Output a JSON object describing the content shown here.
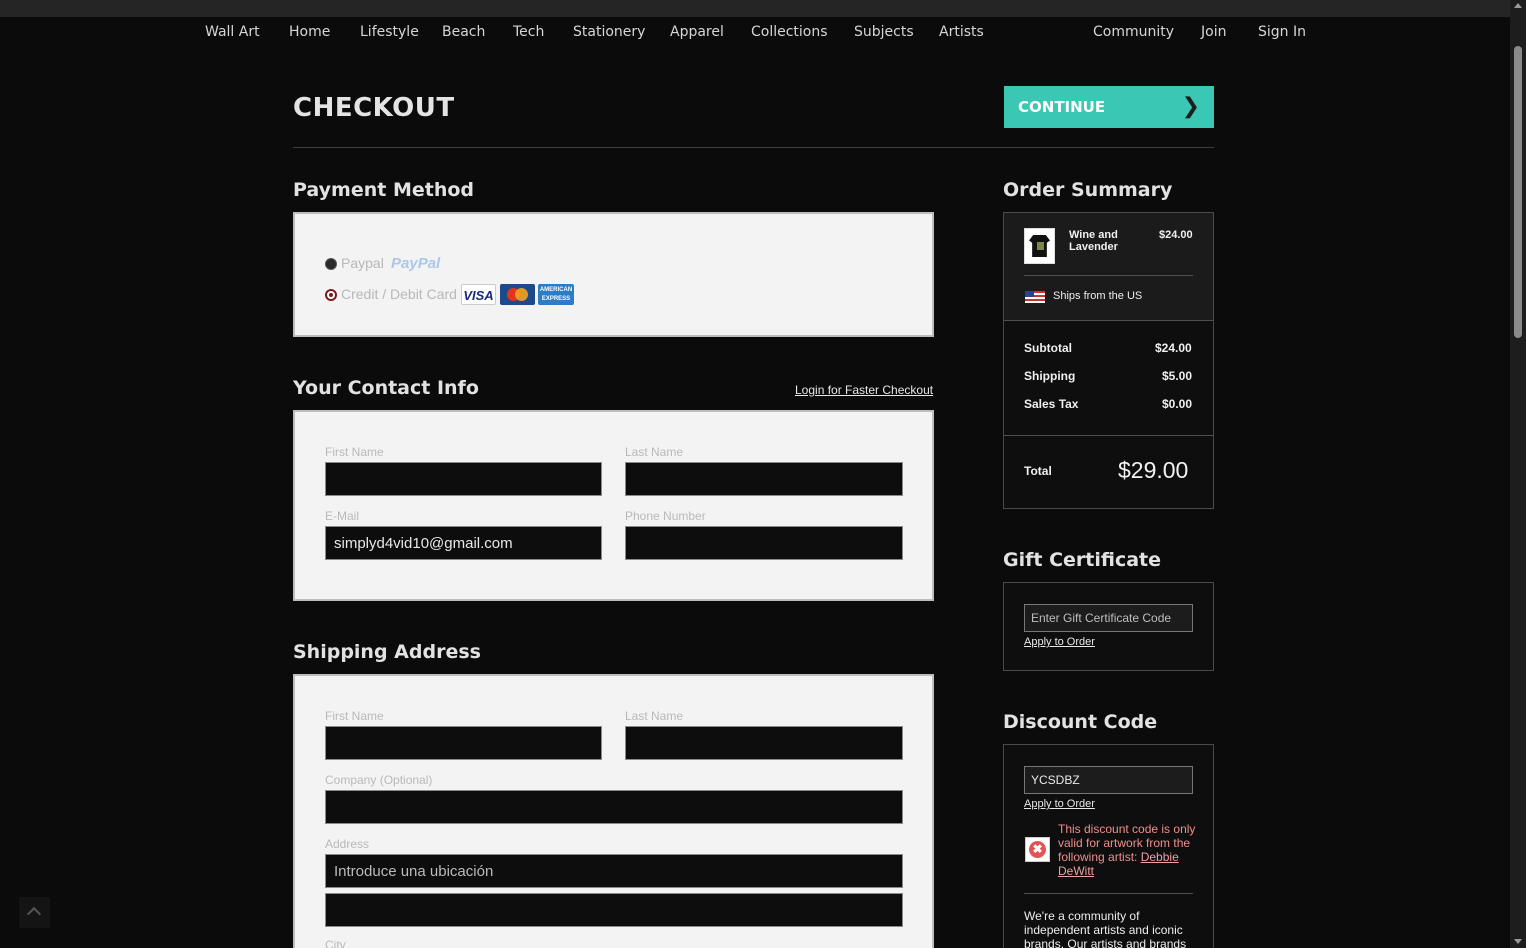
{
  "nav": {
    "left": [
      "Wall Art",
      "Home",
      "Lifestyle",
      "Beach",
      "Tech",
      "Stationery",
      "Apparel",
      "Collections",
      "Subjects",
      "Artists"
    ],
    "right": [
      "Community",
      "Join",
      "Sign In"
    ]
  },
  "header": {
    "title": "CHECKOUT",
    "continue_label": "CONTINUE"
  },
  "payment": {
    "title": "Payment Method",
    "paypal_label": "Paypal",
    "paypal_logo": "PayPal",
    "card_label": "Credit / Debit Card",
    "cards": [
      "VISA",
      "MasterCard",
      "AMERICAN EXPRESS"
    ],
    "selected": "Credit / Debit Card"
  },
  "contact": {
    "title": "Your Contact Info",
    "login_link": "Login for Faster Checkout",
    "first_name_label": "First Name",
    "last_name_label": "Last Name",
    "email_label": "E-Mail",
    "phone_label": "Phone Number",
    "email_value": "simplyd4vid10@gmail.com"
  },
  "shipping": {
    "title": "Shipping Address",
    "first_name_label": "First Name",
    "last_name_label": "Last Name",
    "company_label": "Company (Optional)",
    "address_label": "Address",
    "address_placeholder": "Introduce una ubicación",
    "city_label": "City"
  },
  "order_summary": {
    "title": "Order Summary",
    "item_name": "Wine and Lavender",
    "item_price": "$24.00",
    "ships_from": "Ships from the US",
    "subtotal_label": "Subtotal",
    "subtotal": "$24.00",
    "shipping_label": "Shipping",
    "shipping": "$5.00",
    "tax_label": "Sales Tax",
    "tax": "$0.00",
    "total_label": "Total",
    "total": "$29.00"
  },
  "gift": {
    "title": "Gift Certificate",
    "placeholder": "Enter Gift Certificate Code",
    "apply": "Apply to Order"
  },
  "discount": {
    "title": "Discount Code",
    "code_value": "YCSDBZ",
    "apply": "Apply to Order",
    "error_text": "This discount code is only valid for artwork from the following artist:",
    "artist_link": "Debbie DeWitt",
    "community_text": "We're a community of independent artists and iconic brands. Our artists and brands"
  },
  "colors": {
    "accent": "#3ac8b4",
    "background": "#0b0b0b",
    "error": "#ef8e8e"
  }
}
